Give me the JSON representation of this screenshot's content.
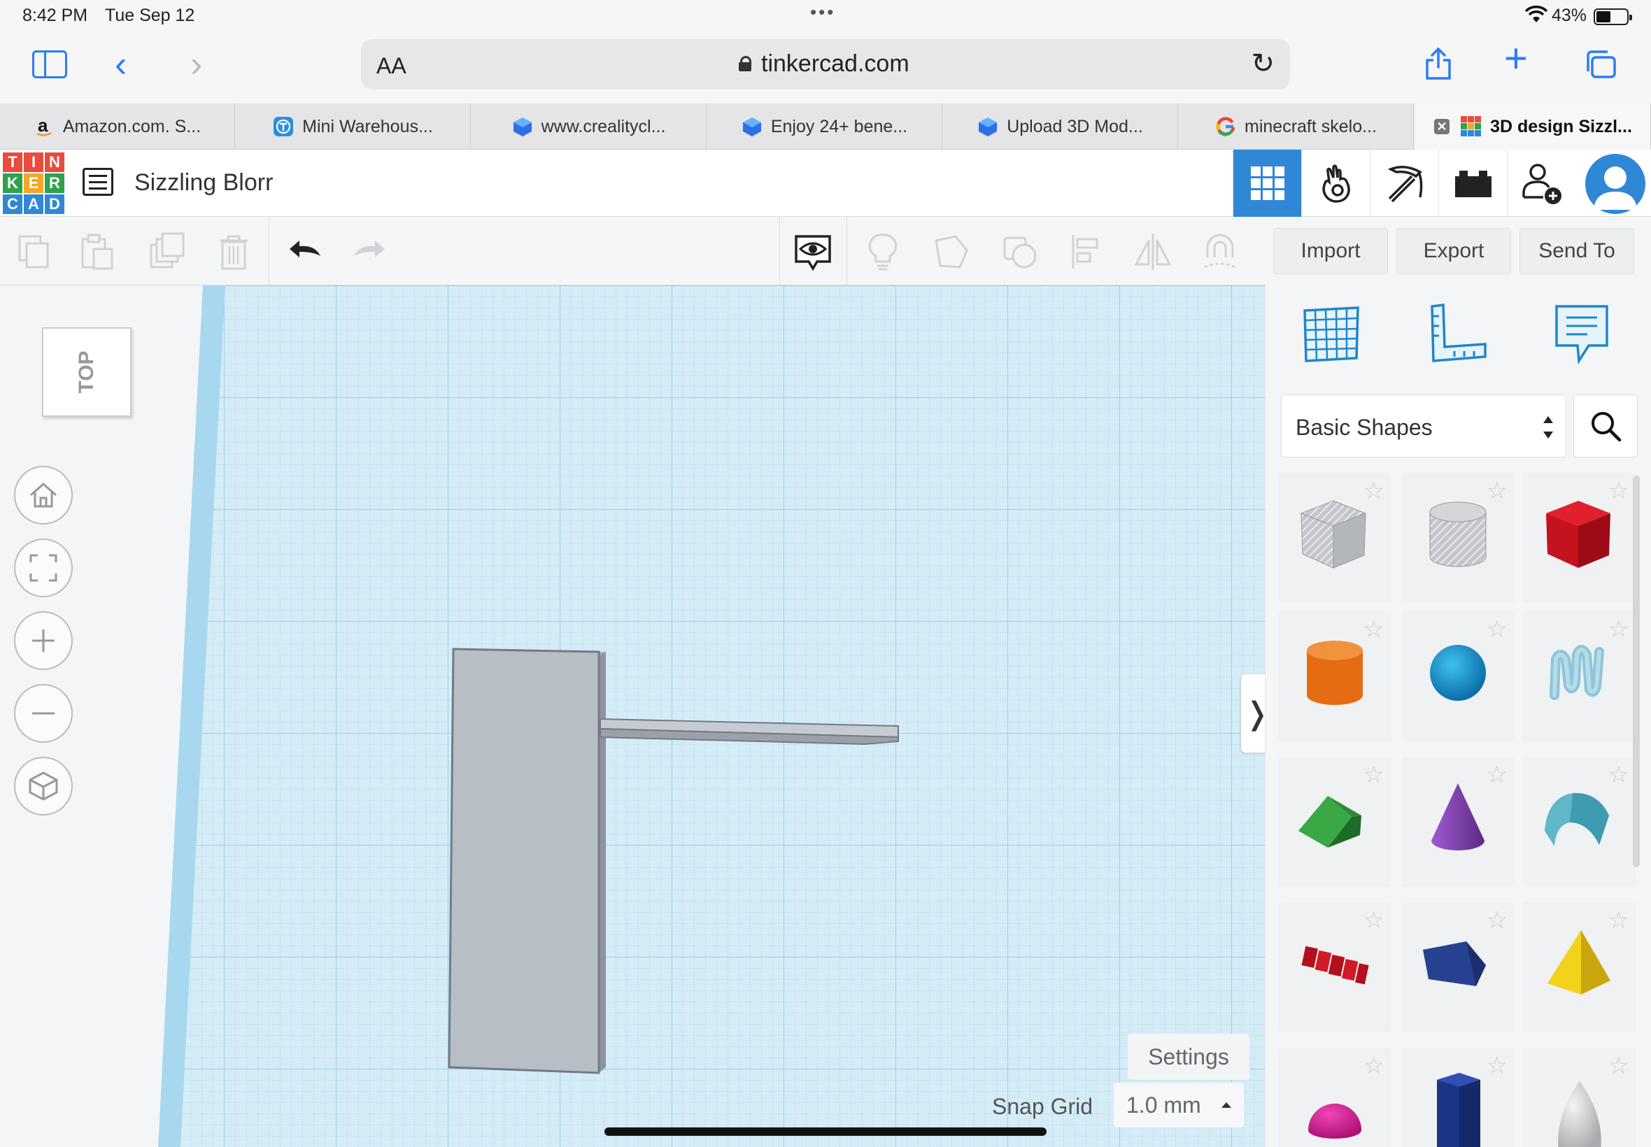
{
  "status_bar": {
    "time": "8:42 PM",
    "date": "Tue Sep 12",
    "battery_pct": "43%",
    "battery_level": 0.43
  },
  "browser": {
    "aa_label": "AA",
    "url": "tinkercad.com"
  },
  "tabs": [
    {
      "label": "Amazon.com. S...",
      "favicon": "amazon-icon",
      "active": false
    },
    {
      "label": "Mini Warehous...",
      "favicon": "thingiverse-icon",
      "active": false
    },
    {
      "label": "www.crealitycl...",
      "favicon": "creality-icon",
      "active": false
    },
    {
      "label": "Enjoy 24+ bene...",
      "favicon": "creality-icon",
      "active": false
    },
    {
      "label": "Upload 3D Mod...",
      "favicon": "creality-icon",
      "active": false
    },
    {
      "label": "minecraft skelo...",
      "favicon": "google-icon",
      "active": false
    },
    {
      "label": "3D design Sizzl...",
      "favicon": "tinkercad-icon",
      "active": true
    }
  ],
  "app": {
    "logo_letters": [
      "T",
      "I",
      "N",
      "K",
      "E",
      "R",
      "C",
      "A",
      "D"
    ],
    "project_title": "Sizzling Blorr",
    "header_buttons": [
      "3d-design-icon",
      "codeblocks-icon",
      "minecraft-pickaxe-icon",
      "lego-bricks-icon",
      "invite-user-icon"
    ]
  },
  "toolbar": {
    "import_label": "Import",
    "export_label": "Export",
    "send_to_label": "Send To"
  },
  "viewport": {
    "view_cube_label": "TOP",
    "settings_label": "Settings",
    "snap_grid_label": "Snap Grid",
    "snap_grid_value": "1.0 mm"
  },
  "shapes_panel": {
    "category": "Basic Shapes",
    "shapes": [
      "box-hole",
      "cylinder-hole",
      "box",
      "cylinder",
      "sphere",
      "scribble",
      "roof",
      "cone",
      "round-roof",
      "text",
      "wedge",
      "pyramid",
      "half-sphere",
      "polygon",
      "paraboloid"
    ]
  },
  "colors": {
    "accent": "#2f87d6",
    "safari_blue": "#2b7cf6",
    "workplane": "#d5ecf7"
  }
}
